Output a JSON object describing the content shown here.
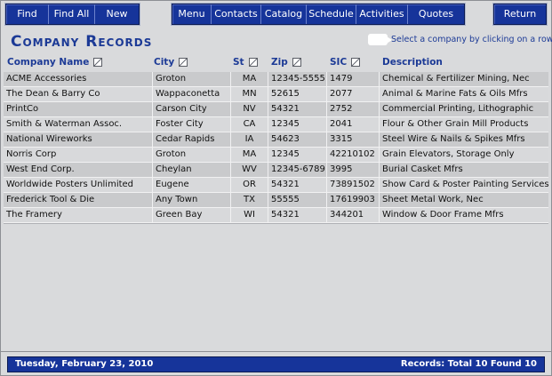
{
  "toolbar": {
    "left": [
      "Find",
      "Find All",
      "New"
    ],
    "middle": [
      "Menu",
      "Contacts",
      "Catalog",
      "Schedule",
      "Activities",
      "Quotes"
    ],
    "right": "Return"
  },
  "page_title": "Company Records",
  "hint": "Select a company by clicking on a row.",
  "columns": [
    "Company Name",
    "City",
    "St",
    "Zip",
    "SIC",
    "Description"
  ],
  "rows": [
    {
      "name": "ACME Accessories",
      "city": "Groton",
      "st": "MA",
      "zip": "12345-5555",
      "sic": "1479",
      "desc": "Chemical & Fertilizer Mining, Nec"
    },
    {
      "name": "The Dean & Barry Co",
      "city": "Wappaconetta",
      "st": "MN",
      "zip": "52615",
      "sic": "2077",
      "desc": "Animal & Marine Fats & Oils Mfrs"
    },
    {
      "name": "PrintCo",
      "city": "Carson City",
      "st": "NV",
      "zip": "54321",
      "sic": "2752",
      "desc": "Commercial Printing, Lithographic"
    },
    {
      "name": "Smith & Waterman Assoc.",
      "city": "Foster City",
      "st": "CA",
      "zip": "12345",
      "sic": "2041",
      "desc": "Flour & Other Grain Mill Products"
    },
    {
      "name": "National Wireworks",
      "city": "Cedar Rapids",
      "st": "IA",
      "zip": "54623",
      "sic": "3315",
      "desc": "Steel Wire & Nails & Spikes Mfrs"
    },
    {
      "name": "Norris Corp",
      "city": "Groton",
      "st": "MA",
      "zip": "12345",
      "sic": "42210102",
      "desc": "Grain Elevators, Storage Only"
    },
    {
      "name": "West End Corp.",
      "city": "Cheylan",
      "st": "WV",
      "zip": "12345-6789",
      "sic": "3995",
      "desc": "Burial Casket Mfrs"
    },
    {
      "name": "Worldwide Posters Unlimited",
      "city": "Eugene",
      "st": "OR",
      "zip": "54321",
      "sic": "73891502",
      "desc": "Show Card & Poster Painting Services"
    },
    {
      "name": "Frederick Tool & Die",
      "city": "Any Town",
      "st": "TX",
      "zip": "55555",
      "sic": "17619903",
      "desc": "Sheet Metal Work, Nec"
    },
    {
      "name": "The Framery",
      "city": "Green Bay",
      "st": "WI",
      "zip": "54321",
      "sic": "344201",
      "desc": "Window & Door Frame Mfrs"
    }
  ],
  "status": {
    "date": "Tuesday, February 23, 2010",
    "records": "Records:  Total 10    Found 10"
  },
  "colors": {
    "accent": "#16349a",
    "title": "#1c3a96",
    "background": "#d9dadc"
  },
  "icons": {
    "sort": "sort-icon",
    "hint": "speech-bubble-icon"
  }
}
